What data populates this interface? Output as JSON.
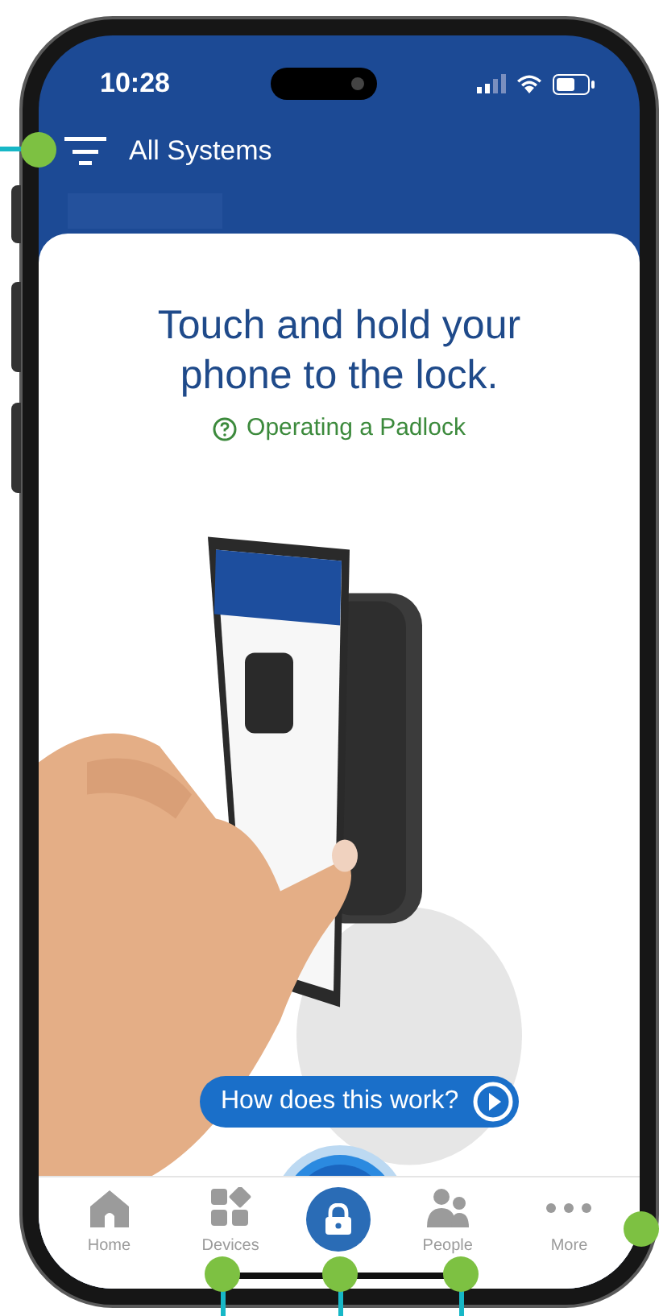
{
  "status_bar": {
    "time": "10:28"
  },
  "header": {
    "title": "All Systems"
  },
  "card": {
    "heading": "Touch and hold your phone to the lock.",
    "help_link": "Operating a Padlock",
    "video_button": "How does this work?"
  },
  "nav": [
    {
      "kind": "tab",
      "label": "Home"
    },
    {
      "kind": "tab",
      "label": "Devices"
    },
    {
      "kind": "action"
    },
    {
      "kind": "tab",
      "label": "People"
    },
    {
      "kind": "tab",
      "label": "More"
    }
  ]
}
